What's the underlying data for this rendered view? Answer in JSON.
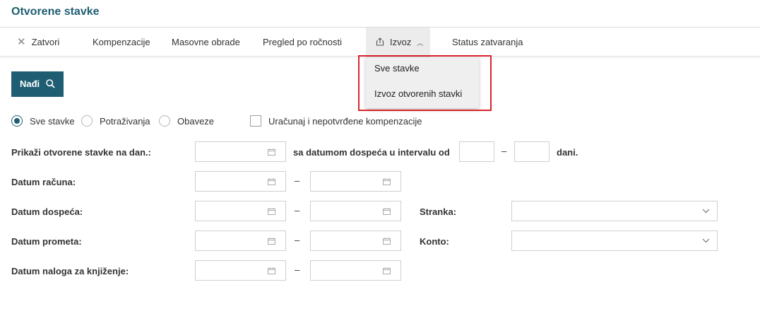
{
  "page": {
    "title": "Otvorene stavke"
  },
  "toolbar": {
    "close": "Zatvori",
    "compensations": "Kompenzacije",
    "bulk": "Masovne obrade",
    "maturity": "Pregled po ročnosti",
    "export": "Izvoz",
    "closing_status": "Status zatvaranja"
  },
  "dropdown": {
    "items": [
      "Sve stavke",
      "Izvoz otvorenih stavki"
    ]
  },
  "find_button": "Nađi",
  "filters": {
    "radios": [
      {
        "label": "Sve stavke",
        "selected": true
      },
      {
        "label": "Potraživanja",
        "selected": false
      },
      {
        "label": "Obaveze",
        "selected": false
      }
    ],
    "checkbox_label": "Uračunaj i nepotvrđene kompenzacije",
    "checkbox_checked": false
  },
  "form": {
    "show_on_date": "Prikaži otvorene stavke na dan.:",
    "due_interval": "sa datumom dospeća u intervalu od",
    "days": "dani.",
    "invoice_date": "Datum računa:",
    "due_date": "Datum dospeća:",
    "transaction_date": "Datum prometa:",
    "posting_date": "Datum naloga za knjiženje:",
    "party": "Stranka:",
    "account": "Konto:",
    "dash": "–"
  },
  "colors": {
    "accent": "#1e5d72",
    "highlight": "#d9242b"
  }
}
